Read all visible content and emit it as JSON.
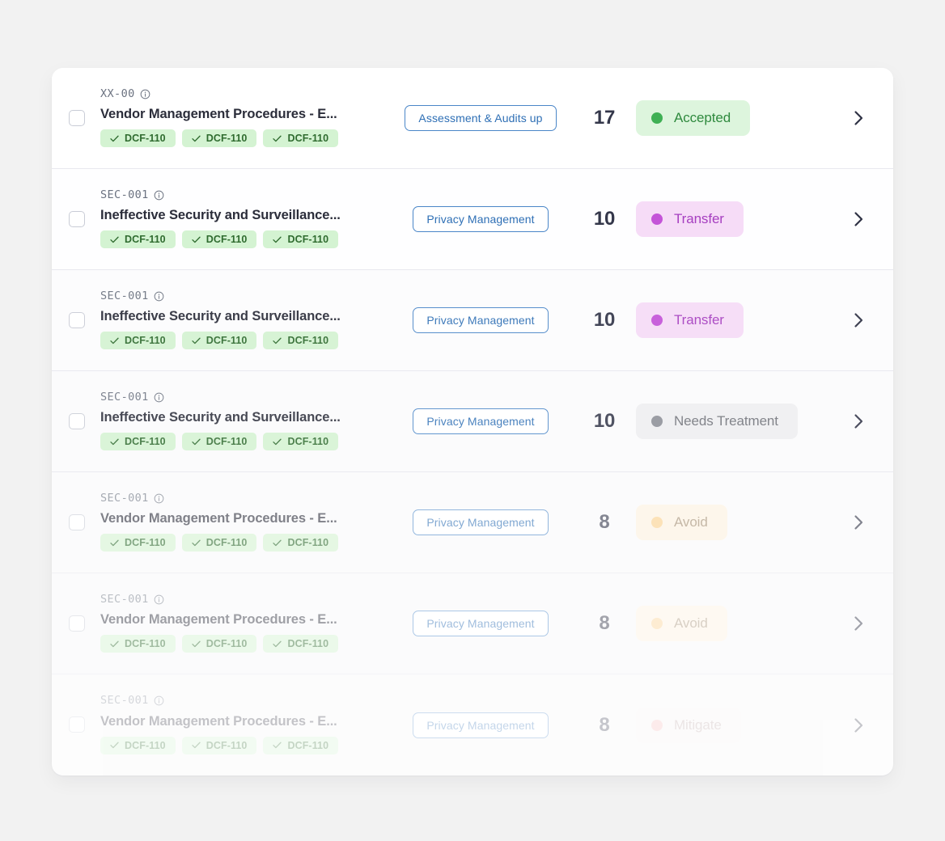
{
  "card": {
    "accent_blue": "#2e6fb5",
    "chip_bg": "#d4f3d2",
    "chip_text": "#2f6b2f"
  },
  "rows": [
    {
      "code": "XX-00",
      "info_icon": "info-circle-icon",
      "title": "Vendor Management Procedures - E...",
      "chips": [
        "DCF-110",
        "DCF-110",
        "DCF-110"
      ],
      "category": "Assessment & Audits up",
      "score": "17",
      "status": "Accepted",
      "status_bg": "#ddf5dd",
      "status_text": "#2f8a3e",
      "status_dot": "#3fb054",
      "opacity": 1,
      "row_bg": "#ffffff"
    },
    {
      "code": "SEC-001",
      "info_icon": "info-circle-icon",
      "title": "Ineffective Security and Surveillance...",
      "chips": [
        "DCF-110",
        "DCF-110",
        "DCF-110"
      ],
      "category": "Privacy Management",
      "score": "10",
      "status": "Transfer",
      "status_bg": "#f6dcf7",
      "status_text": "#a63fc0",
      "status_dot": "#c454d8",
      "opacity": 1,
      "row_bg": "#fefeff"
    },
    {
      "code": "SEC-001",
      "info_icon": "info-circle-icon",
      "title": "Ineffective Security and Surveillance...",
      "chips": [
        "DCF-110",
        "DCF-110",
        "DCF-110"
      ],
      "category": "Privacy Management",
      "score": "10",
      "status": "Transfer",
      "status_bg": "#f6dcf7",
      "status_text": "#a63fc0",
      "status_dot": "#c454d8",
      "opacity": 0.92,
      "row_bg": "#fcfcfd"
    },
    {
      "code": "SEC-001",
      "info_icon": "info-circle-icon",
      "title": "Ineffective Security and Surveillance...",
      "chips": [
        "DCF-110",
        "DCF-110",
        "DCF-110"
      ],
      "category": "Privacy Management",
      "score": "10",
      "status": "Needs Treatment",
      "status_bg": "#eeeef0",
      "status_text": "#6e7078",
      "status_dot": "#8b8d96",
      "opacity": 0.86,
      "row_bg": "#fbfbfc"
    },
    {
      "code": "SEC-001",
      "info_icon": "info-circle-icon",
      "title": "Vendor Management Procedures - E...",
      "chips": [
        "DCF-110",
        "DCF-110",
        "DCF-110"
      ],
      "category": "Privacy Management",
      "score": "8",
      "status": "Avoid",
      "status_bg": "#fdf1de",
      "status_text": "#a08a6d",
      "status_dot": "#fbd08a",
      "opacity": 0.6,
      "row_bg": "#fafafb"
    },
    {
      "code": "SEC-001",
      "info_icon": "info-circle-icon",
      "title": "Vendor Management Procedures - E...",
      "chips": [
        "DCF-110",
        "DCF-110",
        "DCF-110"
      ],
      "category": "Privacy Management",
      "score": "8",
      "status": "Avoid",
      "status_bg": "#fdf3e4",
      "status_text": "#ab9880",
      "status_dot": "#fcd79c",
      "opacity": 0.45,
      "row_bg": "#f8f8f9"
    },
    {
      "code": "SEC-001",
      "info_icon": "info-circle-icon",
      "title": "Vendor Management Procedures - E...",
      "chips": [
        "DCF-110",
        "DCF-110",
        "DCF-110"
      ],
      "category": "Privacy Management",
      "score": "8",
      "status": "Mitigate",
      "status_bg": "#f7f1f1",
      "status_text": "#b9a5a5",
      "status_dot": "#f5b9b9",
      "opacity": 0.28,
      "row_bg": "#f6f6f7"
    }
  ]
}
